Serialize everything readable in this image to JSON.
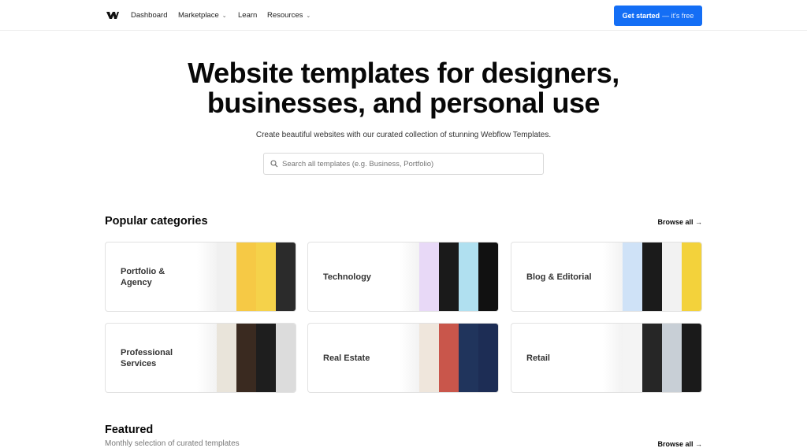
{
  "nav": {
    "items": [
      {
        "label": "Dashboard"
      },
      {
        "label": "Marketplace",
        "dropdown": true
      },
      {
        "label": "Learn"
      },
      {
        "label": "Resources",
        "dropdown": true
      }
    ],
    "cta": {
      "label": "Get started",
      "suffix": "— it's free"
    },
    "brand_color": "#146ef5"
  },
  "hero": {
    "title_line1": "Website templates for designers,",
    "title_line2": "businesses, and personal use",
    "subtitle": "Create beautiful websites with our curated collection of stunning Webflow Templates.",
    "search_placeholder": "Search all templates (e.g. Business, Portfolio)"
  },
  "popular": {
    "title": "Popular categories",
    "browse_all": "Browse all",
    "categories": [
      {
        "label": "Portfolio & Agency",
        "colors": [
          "#f0f0f0",
          "#f6c945",
          "#f5d24a",
          "#2b2b2b"
        ]
      },
      {
        "label": "Technology",
        "colors": [
          "#e8d9f7",
          "#1a1a1a",
          "#b0e0f0",
          "#111"
        ]
      },
      {
        "label": "Blog & Editorial",
        "colors": [
          "#cfe2f7",
          "#1b1b1b",
          "#f2f2f2",
          "#f3d23b"
        ]
      },
      {
        "label": "Professional Services",
        "colors": [
          "#e9e4da",
          "#3a2a20",
          "#1e1e1e",
          "#dcdcdc"
        ]
      },
      {
        "label": "Real Estate",
        "colors": [
          "#efe6dc",
          "#c9564b",
          "#20345c",
          "#1d2d55"
        ]
      },
      {
        "label": "Retail",
        "colors": [
          "#f4f4f4",
          "#262626",
          "#c8cfd6",
          "#1a1a1a"
        ]
      }
    ]
  },
  "featured": {
    "title": "Featured",
    "subtitle": "Monthly selection of curated templates",
    "browse_all": "Browse all"
  }
}
